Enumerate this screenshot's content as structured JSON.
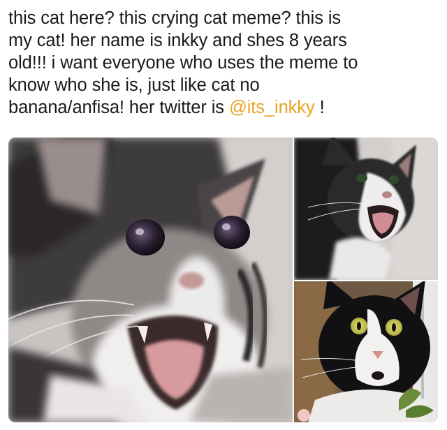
{
  "post": {
    "lines": [
      "this cat here? this crying cat meme? this is",
      "my cat! her name is inkky and shes 8 years",
      "old!!! i want everyone who uses the meme to",
      "know who she is, just like cat no"
    ],
    "last_line_prefix": "banana/anfisa! her twitter is ",
    "mention": "@its_inkky",
    "last_line_suffix": " !"
  },
  "photos": [
    {
      "subject": "crying-cat-closeup"
    },
    {
      "subject": "crying-cat-side"
    },
    {
      "subject": "surprised-cat"
    }
  ],
  "colors": {
    "mention": "#e8a323",
    "text": "#1a1a1a"
  }
}
